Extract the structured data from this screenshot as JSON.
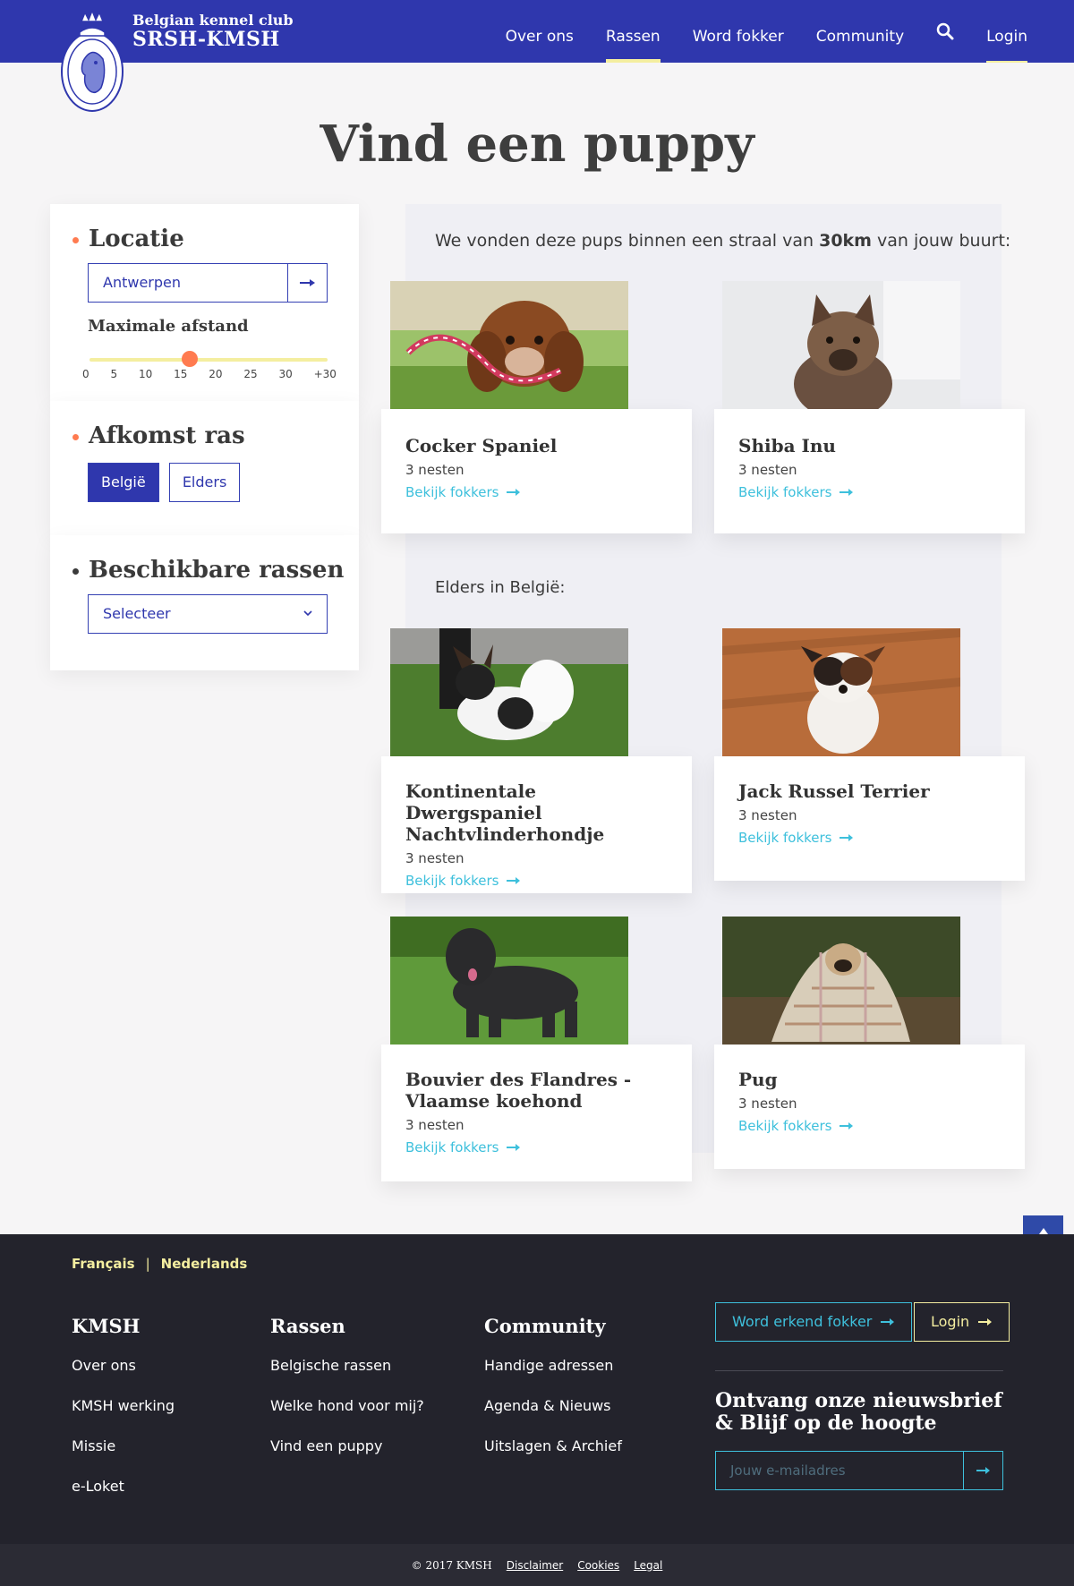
{
  "brand": {
    "line1": "Belgian kennel club",
    "line2": "SRSH-KMSH"
  },
  "nav": {
    "items": [
      "Over ons",
      "Rassen",
      "Word fokker",
      "Community"
    ],
    "active": "Rassen",
    "login": "Login"
  },
  "page_title": "Vind een puppy",
  "filters": {
    "location": {
      "heading": "Locatie",
      "value": "Antwerpen"
    },
    "distance": {
      "heading": "Maximale afstand",
      "ticks": [
        "0",
        "5",
        "10",
        "15",
        "20",
        "25",
        "30",
        "+30"
      ],
      "selected": "15"
    },
    "origin": {
      "heading": "Afkomst ras",
      "options": [
        "België",
        "Elders"
      ],
      "selected": "België"
    },
    "breeds": {
      "heading": "Beschikbare rassen",
      "placeholder": "Selecteer"
    }
  },
  "results": {
    "intro_prefix": "We vonden deze pups binnen een straal van ",
    "intro_bold": "30km",
    "intro_suffix": " van jouw buurt:",
    "elsewhere_heading": "Elders in België:",
    "link_label": "Bekijk fokkers",
    "cards": [
      {
        "name": "Cocker Spaniel",
        "count": "3 nesten"
      },
      {
        "name": "Shiba Inu",
        "count": "3 nesten"
      },
      {
        "name": "Kontinentale Dwergspaniel Nachtvlinderhondje",
        "count": "3 nesten"
      },
      {
        "name": "Jack Russel Terrier",
        "count": "3 nesten"
      },
      {
        "name": "Bouvier des Flandres - Vlaamse koehond",
        "count": "3 nesten"
      },
      {
        "name": "Pug",
        "count": "3 nesten"
      }
    ]
  },
  "footer": {
    "languages": [
      "Français",
      "Nederlands"
    ],
    "columns": [
      {
        "heading": "KMSH",
        "links": [
          "Over ons",
          "KMSH werking",
          "Missie",
          "e-Loket"
        ]
      },
      {
        "heading": "Rassen",
        "links": [
          "Belgische rassen",
          "Welke hond voor mij?",
          "Vind een puppy"
        ]
      },
      {
        "heading": "Community",
        "links": [
          "Handige adressen",
          "Agenda & Nieuws",
          "Uitslagen & Archief"
        ]
      }
    ],
    "cta_breeder": "Word erkend fokker",
    "cta_login": "Login",
    "newsletter_line1": "Ontvang onze nieuwsbrief",
    "newsletter_line2": "& Blijf op de hoogte",
    "email_placeholder": "Jouw e-mailadres",
    "copyright": "© 2017 KMSH",
    "legal_links": [
      "Disclaimer",
      "Cookies",
      "Legal"
    ]
  },
  "colors": {
    "primary": "#2f37ad",
    "accent_yellow": "#f4eea0",
    "accent_orange": "#ff7b50",
    "link_cyan": "#3ec0dc",
    "footer_bg": "#23232c"
  }
}
